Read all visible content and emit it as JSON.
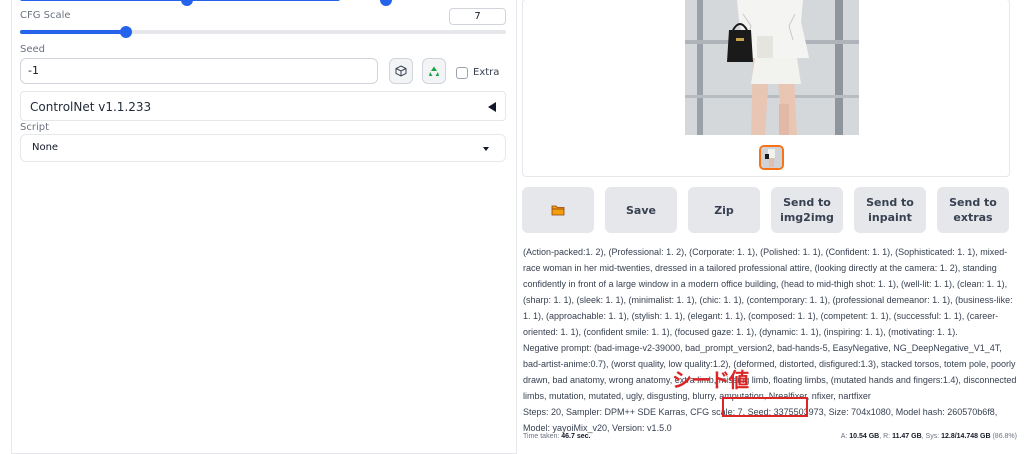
{
  "left": {
    "cfg": {
      "label": "CFG Scale",
      "value": "7"
    },
    "seed": {
      "label": "Seed",
      "value": "-1",
      "extra_label": "Extra"
    },
    "controlnet": {
      "title": "ControlNet v1.1.233"
    },
    "script": {
      "label": "Script",
      "value": "None"
    },
    "icons": {
      "random": "dice-icon",
      "reuse": "recycle-icon"
    }
  },
  "right": {
    "buttons": {
      "folder": "folder-icon",
      "save": "Save",
      "zip": "Zip",
      "img2img_line1": "Send to",
      "img2img_line2": "img2img",
      "inpaint_line1": "Send to",
      "inpaint_line2": "inpaint",
      "extras_line1": "Send to",
      "extras_line2": "extras"
    },
    "prompt": "(Action-packed:1. 2), (Professional: 1. 2), (Corporate: 1. 1), (Polished: 1. 1), (Confident: 1. 1), (Sophisticated: 1. 1), mixed-race woman in her mid-twenties, dressed in a tailored professional attire, (looking directly at the camera: 1. 2), standing confidently in front of a large window in a modern office building, (head to mid-thigh shot: 1. 1), (well-lit: 1. 1), (clean: 1. 1), (sharp: 1. 1), (sleek: 1. 1), (minimalist: 1. 1), (chic: 1. 1), (contemporary: 1. 1), (professional demeanor: 1. 1), (business-like: 1. 1), (approachable: 1. 1), (stylish: 1. 1), (elegant: 1. 1), (composed: 1. 1), (competent: 1. 1), (successful: 1. 1), (career-oriented: 1. 1), (confident smile: 1. 1), (focused gaze: 1. 1), (dynamic: 1. 1), (inspiring: 1. 1), (motivating: 1. 1).",
    "negative": "Negative prompt: (bad-image-v2-39000, bad_prompt_version2, bad-hands-5, EasyNegative, NG_DeepNegative_V1_4T, bad-artist-anime:0.7), (worst quality, low quality:1.2), (deformed, distorted, disfigured:1.3), stacked torsos, totem pole, poorly drawn, bad anatomy, wrong anatomy, extra limb, missing limb, floating limbs, (mutated hands and fingers:1.4), disconnected limbs, mutation, mutated, ugly, disgusting, blurry, amputation, Nrealfixer, nfixer, nartfixer",
    "steps_before": "Steps: 20, Sampler: DPM++ SDE Karras, CFG scale: 7",
    "steps_seed": ", Seed: 3375503973,",
    "steps_after": " Size: 704x1080, Model hash: 260570b6f8, Model: yayoiMix_v20, Version: v1.5.0",
    "annotation": "シード値",
    "footer": {
      "time_label": "Time taken: ",
      "time_value": "46.7 sec.",
      "a_label": "A: ",
      "a_value": "10.54 GB",
      "r_label": ", R: ",
      "r_value": "11.47 GB",
      "sys_label": ", Sys: ",
      "sys_value": "12.8/14.748 GB",
      "sys_pct": " (86.8%)"
    }
  },
  "colors": {
    "accent": "#2563eb",
    "annotation": "#dc2626",
    "thumb_border": "#f97316"
  }
}
